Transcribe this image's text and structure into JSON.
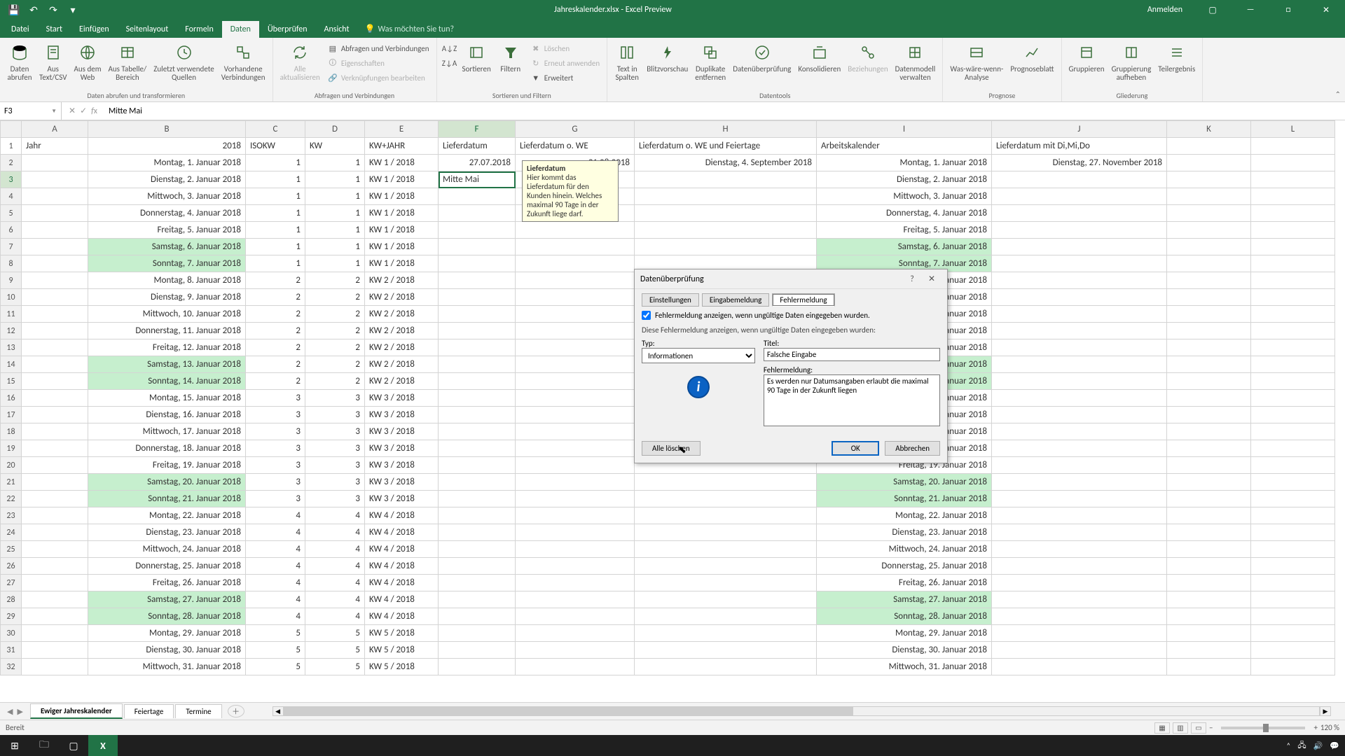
{
  "title": "Jahreskalender.xlsx - Excel Preview",
  "signin": "Anmelden",
  "ribbon_tabs": [
    "Datei",
    "Start",
    "Einfügen",
    "Seitenlayout",
    "Formeln",
    "Daten",
    "Überprüfen",
    "Ansicht"
  ],
  "tell_me": "Was möchten Sie tun?",
  "ribbon": {
    "get_data": {
      "daten_abrufen": "Daten\nabrufen",
      "aus_text": "Aus\nText/CSV",
      "aus_web": "Aus dem\nWeb",
      "aus_tabelle": "Aus Tabelle/\nBereich",
      "zuletzt": "Zuletzt verwendete\nQuellen",
      "vorhandene": "Vorhandene\nVerbindungen",
      "group": "Daten abrufen und transformieren"
    },
    "refresh": {
      "alle": "Alle\naktualisieren",
      "abfragen": "Abfragen und Verbindungen",
      "eigenschaften": "Eigenschaften",
      "verknuepfungen": "Verknüpfungen bearbeiten",
      "group": "Abfragen und Verbindungen"
    },
    "sort": {
      "sortieren": "Sortieren",
      "filtern": "Filtern",
      "loeschen": "Löschen",
      "erneut": "Erneut anwenden",
      "erweitert": "Erweitert",
      "group": "Sortieren und Filtern"
    },
    "data_tools": {
      "text_in_spalten": "Text in\nSpalten",
      "blitz": "Blitzvorschau",
      "duplikate": "Duplikate\nentfernen",
      "datenueberpr": "Datenüberprüfung",
      "konsolidieren": "Konsolidieren",
      "beziehungen": "Beziehungen",
      "datenmodell": "Datenmodell\nverwalten",
      "group": "Datentools"
    },
    "forecast": {
      "was_waere": "Was-wäre-wenn-\nAnalyse",
      "prognoseblatt": "Prognoseblatt",
      "group": "Prognose"
    },
    "outline": {
      "gruppieren": "Gruppieren",
      "gruppierung_aufheben": "Gruppierung\naufheben",
      "teilergebnis": "Teilergebnis",
      "group": "Gliederung"
    }
  },
  "name_box": "F3",
  "formula_value": "Mitte Mai",
  "columns": [
    "A",
    "B",
    "C",
    "D",
    "E",
    "F",
    "G",
    "H",
    "I",
    "J",
    "K",
    "L"
  ],
  "headers": {
    "A": "Jahr",
    "B": "2018",
    "C": "ISOKW",
    "D": "KW",
    "E": "KW+JAHR",
    "F": "Lieferdatum",
    "G": "Lieferdatum o. WE",
    "H": "Lieferdatum o. WE und Feiertage",
    "I": "Arbeitskalender",
    "J": "Lieferdatum mit Di,Mi,Do",
    "K": "",
    "L": ""
  },
  "rows": [
    {
      "n": 2,
      "B": "Montag, 1. Januar 2018",
      "C": "1",
      "D": "1",
      "E": "KW 1 / 2018",
      "F": "27.07.2018",
      "G": "31.08.2018",
      "H": "Dienstag, 4. September 2018",
      "I": "Montag, 1. Januar 2018",
      "J": "Dienstag, 27. November 2018"
    },
    {
      "n": 3,
      "B": "Dienstag, 2. Januar 2018",
      "C": "1",
      "D": "1",
      "E": "KW 1 / 2018",
      "F": "Mitte Mai",
      "G": "",
      "H": "",
      "I": "Dienstag, 2. Januar 2018",
      "J": "",
      "active": true
    },
    {
      "n": 4,
      "B": "Mittwoch, 3. Januar 2018",
      "C": "1",
      "D": "1",
      "E": "KW 1 / 2018",
      "I": "Mittwoch, 3. Januar 2018"
    },
    {
      "n": 5,
      "B": "Donnerstag, 4. Januar 2018",
      "C": "1",
      "D": "1",
      "E": "KW 1 / 2018",
      "I": "Donnerstag, 4. Januar 2018"
    },
    {
      "n": 6,
      "B": "Freitag, 5. Januar 2018",
      "C": "1",
      "D": "1",
      "E": "KW 1 / 2018",
      "I": "Freitag, 5. Januar 2018"
    },
    {
      "n": 7,
      "B": "Samstag, 6. Januar 2018",
      "C": "1",
      "D": "1",
      "E": "KW 1 / 2018",
      "I": "Samstag, 6. Januar 2018",
      "wkend": true
    },
    {
      "n": 8,
      "B": "Sonntag, 7. Januar 2018",
      "C": "1",
      "D": "1",
      "E": "KW 1 / 2018",
      "I": "Sonntag, 7. Januar 2018",
      "wkend": true
    },
    {
      "n": 9,
      "B": "Montag, 8. Januar 2018",
      "C": "2",
      "D": "2",
      "E": "KW 2 / 2018",
      "I": "Montag, 8. Januar 2018"
    },
    {
      "n": 10,
      "B": "Dienstag, 9. Januar 2018",
      "C": "2",
      "D": "2",
      "E": "KW 2 / 2018",
      "I": "Dienstag, 9. Januar 2018"
    },
    {
      "n": 11,
      "B": "Mittwoch, 10. Januar 2018",
      "C": "2",
      "D": "2",
      "E": "KW 2 / 2018",
      "I": "Mittwoch, 10. Januar 2018"
    },
    {
      "n": 12,
      "B": "Donnerstag, 11. Januar 2018",
      "C": "2",
      "D": "2",
      "E": "KW 2 / 2018",
      "I": "Donnerstag, 11. Januar 2018"
    },
    {
      "n": 13,
      "B": "Freitag, 12. Januar 2018",
      "C": "2",
      "D": "2",
      "E": "KW 2 / 2018",
      "I": "Freitag, 12. Januar 2018"
    },
    {
      "n": 14,
      "B": "Samstag, 13. Januar 2018",
      "C": "2",
      "D": "2",
      "E": "KW 2 / 2018",
      "I": "Samstag, 13. Januar 2018",
      "wkend": true
    },
    {
      "n": 15,
      "B": "Sonntag, 14. Januar 2018",
      "C": "2",
      "D": "2",
      "E": "KW 2 / 2018",
      "I": "Sonntag, 14. Januar 2018",
      "wkend": true
    },
    {
      "n": 16,
      "B": "Montag, 15. Januar 2018",
      "C": "3",
      "D": "3",
      "E": "KW 3 / 2018",
      "I": "Montag, 15. Januar 2018"
    },
    {
      "n": 17,
      "B": "Dienstag, 16. Januar 2018",
      "C": "3",
      "D": "3",
      "E": "KW 3 / 2018",
      "I": "Dienstag, 16. Januar 2018"
    },
    {
      "n": 18,
      "B": "Mittwoch, 17. Januar 2018",
      "C": "3",
      "D": "3",
      "E": "KW 3 / 2018",
      "I": "Mittwoch, 17. Januar 2018"
    },
    {
      "n": 19,
      "B": "Donnerstag, 18. Januar 2018",
      "C": "3",
      "D": "3",
      "E": "KW 3 / 2018",
      "I": "Donnerstag, 18. Januar 2018"
    },
    {
      "n": 20,
      "B": "Freitag, 19. Januar 2018",
      "C": "3",
      "D": "3",
      "E": "KW 3 / 2018",
      "I": "Freitag, 19. Januar 2018"
    },
    {
      "n": 21,
      "B": "Samstag, 20. Januar 2018",
      "C": "3",
      "D": "3",
      "E": "KW 3 / 2018",
      "I": "Samstag, 20. Januar 2018",
      "wkend": true
    },
    {
      "n": 22,
      "B": "Sonntag, 21. Januar 2018",
      "C": "3",
      "D": "3",
      "E": "KW 3 / 2018",
      "I": "Sonntag, 21. Januar 2018",
      "wkend": true
    },
    {
      "n": 23,
      "B": "Montag, 22. Januar 2018",
      "C": "4",
      "D": "4",
      "E": "KW 4 / 2018",
      "I": "Montag, 22. Januar 2018"
    },
    {
      "n": 24,
      "B": "Dienstag, 23. Januar 2018",
      "C": "4",
      "D": "4",
      "E": "KW 4 / 2018",
      "I": "Dienstag, 23. Januar 2018"
    },
    {
      "n": 25,
      "B": "Mittwoch, 24. Januar 2018",
      "C": "4",
      "D": "4",
      "E": "KW 4 / 2018",
      "I": "Mittwoch, 24. Januar 2018"
    },
    {
      "n": 26,
      "B": "Donnerstag, 25. Januar 2018",
      "C": "4",
      "D": "4",
      "E": "KW 4 / 2018",
      "I": "Donnerstag, 25. Januar 2018"
    },
    {
      "n": 27,
      "B": "Freitag, 26. Januar 2018",
      "C": "4",
      "D": "4",
      "E": "KW 4 / 2018",
      "I": "Freitag, 26. Januar 2018"
    },
    {
      "n": 28,
      "B": "Samstag, 27. Januar 2018",
      "C": "4",
      "D": "4",
      "E": "KW 4 / 2018",
      "I": "Samstag, 27. Januar 2018",
      "wkend": true
    },
    {
      "n": 29,
      "B": "Sonntag, 28. Januar 2018",
      "C": "4",
      "D": "4",
      "E": "KW 4 / 2018",
      "I": "Sonntag, 28. Januar 2018",
      "wkend": true
    },
    {
      "n": 30,
      "B": "Montag, 29. Januar 2018",
      "C": "5",
      "D": "5",
      "E": "KW 5 / 2018",
      "I": "Montag, 29. Januar 2018"
    },
    {
      "n": 31,
      "B": "Dienstag, 30. Januar 2018",
      "C": "5",
      "D": "5",
      "E": "KW 5 / 2018",
      "I": "Dienstag, 30. Januar 2018"
    },
    {
      "n": 32,
      "B": "Mittwoch, 31. Januar 2018",
      "C": "5",
      "D": "5",
      "E": "KW 5 / 2018",
      "I": "Mittwoch, 31. Januar 2018"
    }
  ],
  "tooltip": {
    "title": "Lieferdatum",
    "body": "Hier kommt das Lieferdatum für den Kunden hinein. Welches maximal 90 Tage in der Zukunft liege darf."
  },
  "dialog": {
    "title": "Datenüberprüfung",
    "tabs": [
      "Einstellungen",
      "Eingabemeldung",
      "Fehlermeldung"
    ],
    "chk": "Fehlermeldung anzeigen, wenn ungültige Daten eingegeben wurden.",
    "desc": "Diese Fehlermeldung anzeigen, wenn ungültige Daten eingegeben wurden:",
    "typ_label": "Typ:",
    "typ_value": "Informationen",
    "titel_label": "Titel:",
    "titel_value": "Falsche Eingabe",
    "fehler_label": "Fehlermeldung:",
    "fehler_value": "Es werden nur Datumsangaben erlaubt die maximal 90 Tage in der Zukunft liegen",
    "clear": "Alle löschen",
    "ok": "OK",
    "cancel": "Abbrechen"
  },
  "sheet_tabs": [
    "Ewiger Jahreskalender",
    "Feiertage",
    "Termine"
  ],
  "status": {
    "ready": "Bereit",
    "zoom": "120 %"
  },
  "taskbar_time": ""
}
